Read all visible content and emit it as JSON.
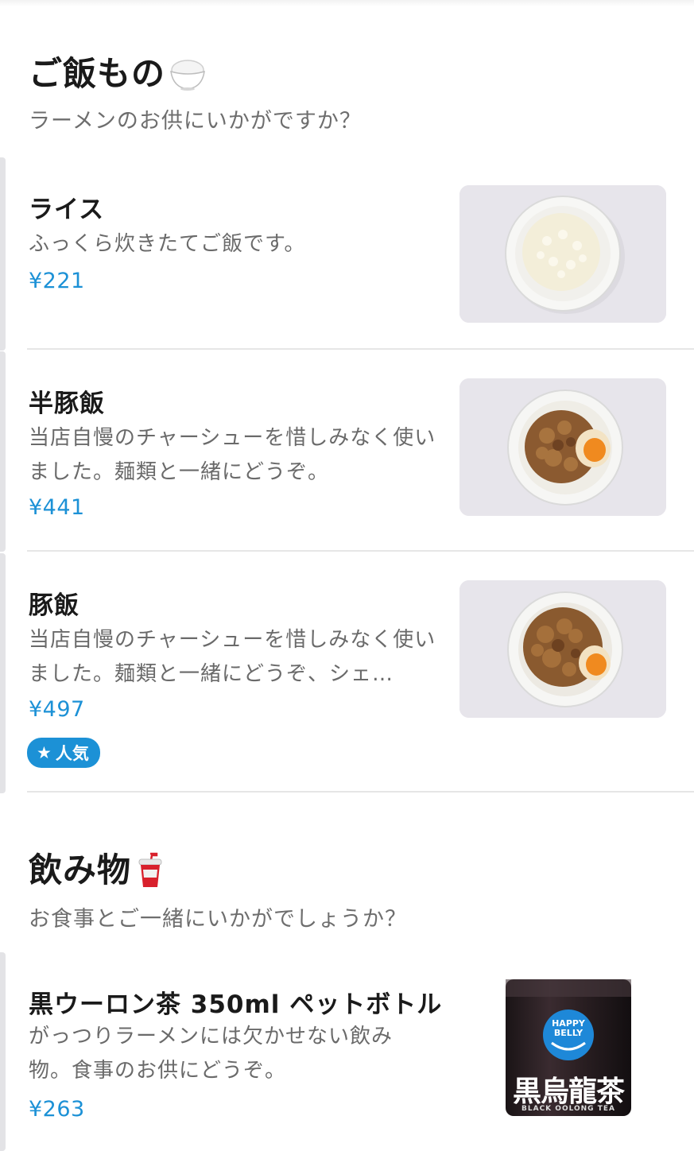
{
  "sections": [
    {
      "title": "ご飯もの",
      "emoji": "🍚",
      "subtitle": "ラーメンのお供にいかがですか？",
      "items": [
        {
          "name": "ライス",
          "description": "ふっくら炊きたてご飯です。",
          "price": "¥221",
          "image": "rice-bowl"
        },
        {
          "name": "半豚飯",
          "description": "当店自慢のチャーシューを惜しみなく使いました。麺類と一緒にどうぞ。",
          "price": "¥441",
          "image": "pork-rice-bowl-half"
        },
        {
          "name": "豚飯",
          "description": "当店自慢のチャーシューを惜しみなく使いました。麺類と一緒にどうぞ、シェ…",
          "price": "¥497",
          "image": "pork-rice-bowl",
          "badge": "人気",
          "badge_icon": "★"
        }
      ]
    },
    {
      "title": "飲み物",
      "emoji": "🥤",
      "subtitle": "お食事とご一緒にいかがでしょうか？",
      "items": [
        {
          "name": "黒ウーロン茶 350ml ペットボトル",
          "description": "がっつりラーメンには欠かせない飲み物。食事のお供にどうぞ。",
          "price": "¥263",
          "image": "black-oolong-tea-bottle",
          "bottle_label": "黒烏龍茶",
          "bottle_brand": "HAPPY BELLY",
          "bottle_sub": "BLACK OOLONG TEA"
        }
      ]
    }
  ],
  "colors": {
    "price": "#1c91d6",
    "badge": "#1c91d6",
    "divider": "#e6e6e6"
  }
}
